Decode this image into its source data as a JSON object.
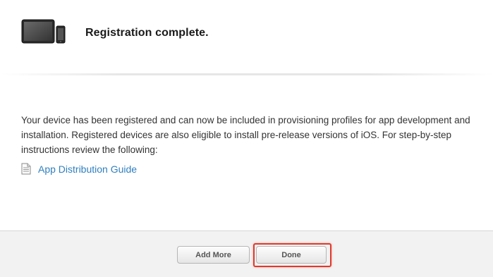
{
  "header": {
    "title": "Registration complete.",
    "icon": "ipad-iphone-devices-icon"
  },
  "main": {
    "description": "Your device has been registered and can now be included in provisioning profiles for app development and installation. Registered devices are also eligible to install pre-release versions of iOS. For step-by-step instructions review the following:",
    "guide_link": {
      "label": "App Distribution Guide",
      "icon": "document-icon",
      "color": "#2f7fbf"
    }
  },
  "footer": {
    "add_more_label": "Add More",
    "done_label": "Done",
    "highlight_color": "#e0392c"
  }
}
